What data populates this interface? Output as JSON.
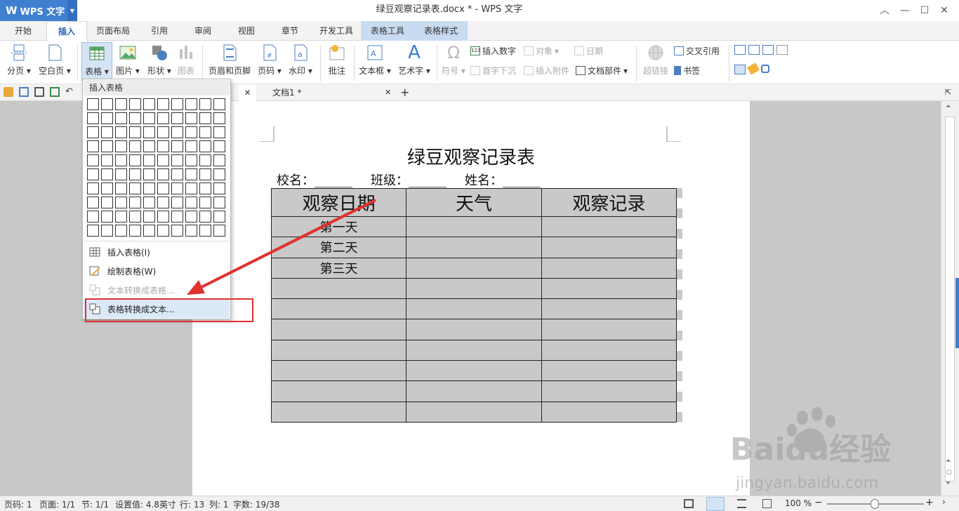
{
  "app": {
    "name": "WPS 文字",
    "window_title": "绿豆观察记录表.docx * - WPS 文字"
  },
  "ribbon_tabs": [
    "开始",
    "插入",
    "页面布局",
    "引用",
    "审阅",
    "视图",
    "章节",
    "开发工具",
    "表格工具",
    "表格样式"
  ],
  "active_tab": "插入",
  "ribbon": {
    "fenye": "分页",
    "kongbaiye": "空白页",
    "biaoge": "表格",
    "tupian": "图片",
    "xingzhuang": "形状",
    "tubiao": "图表",
    "yemei": "页眉和页脚",
    "yema": "页码",
    "shuiyin": "水印",
    "pizhu": "批注",
    "wenbenkuang": "文本框",
    "yishuzi": "艺术字",
    "fuhao": "符号",
    "charu_shuzi": "插入数字",
    "duixiang": "对象",
    "riqi": "日期",
    "shouzi_xiachen": "首字下沉",
    "charu_fujian": "插入附件",
    "wendang_bujian": "文档部件",
    "chaolianjie": "超链接",
    "jiaocha_yinyong": "交叉引用",
    "shuqian": "书签"
  },
  "doc_tabs": {
    "second": "文档1 *"
  },
  "table_menu": {
    "header": "插入表格",
    "items": [
      "插入表格(I)",
      "绘制表格(W)",
      "文本转换成表格...",
      "表格转换成文本..."
    ]
  },
  "document": {
    "title": "绿豆观察记录表",
    "meta": [
      "校名：______",
      "班级：______",
      "姓名：______"
    ],
    "table_headers": [
      "观察日期",
      "天气",
      "观察记录"
    ],
    "rows": [
      [
        "第一天",
        "",
        ""
      ],
      [
        "第二天",
        "",
        ""
      ],
      [
        "第三天",
        "",
        ""
      ],
      [
        "",
        "",
        ""
      ],
      [
        "",
        "",
        ""
      ],
      [
        "",
        "",
        ""
      ],
      [
        "",
        "",
        ""
      ],
      [
        "",
        "",
        ""
      ],
      [
        "",
        "",
        ""
      ],
      [
        "",
        "",
        ""
      ]
    ]
  },
  "status": {
    "page_num": "页码: 1",
    "pages": "页面: 1/1",
    "section": "节: 1/1",
    "setting": "设置值: 4.8英寸",
    "row": "行: 13",
    "col": "列: 1",
    "words": "字数: 19/38",
    "zoom": "100 %"
  },
  "watermark": {
    "brand": "Baidu经验",
    "url": "jingyan.baidu.com"
  },
  "colors": {
    "accent": "#3f7fd0",
    "highlight_box": "#e03030",
    "arrow": "#e03030",
    "table_fill": "#c9c9c9"
  }
}
